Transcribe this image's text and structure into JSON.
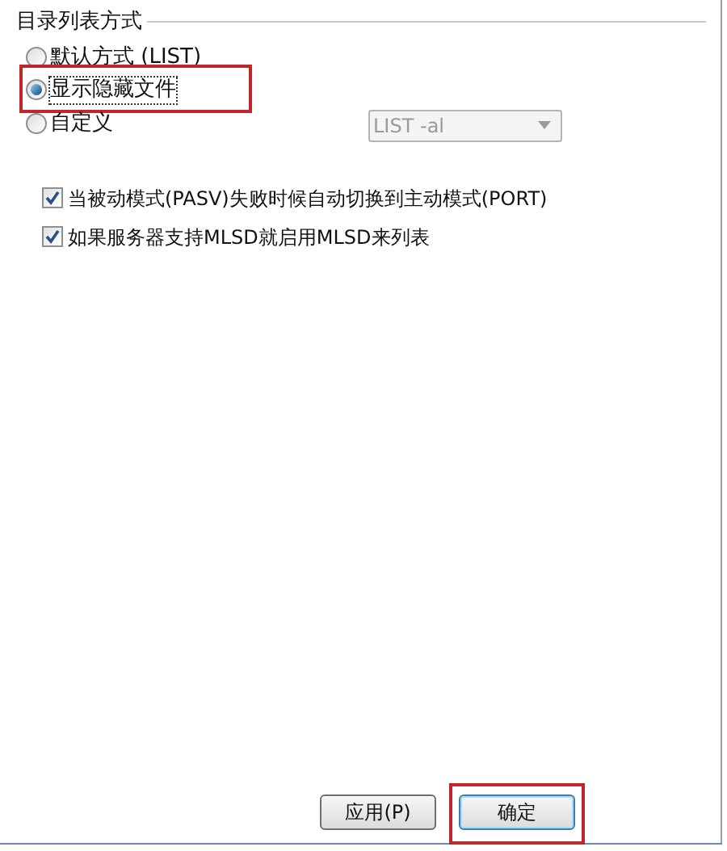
{
  "group": {
    "title": "目录列表方式"
  },
  "list_modes": [
    {
      "label": "默认方式 (LIST)",
      "selected": false,
      "focused": false,
      "highlighted": false
    },
    {
      "label": "显示隐藏文件",
      "selected": true,
      "focused": true,
      "highlighted": true
    },
    {
      "label": "自定义",
      "selected": false,
      "focused": false,
      "highlighted": false
    }
  ],
  "custom_command": {
    "value": "LIST -al",
    "disabled": true
  },
  "options": [
    {
      "label": "当被动模式(PASV)失败时候自动切换到主动模式(PORT)",
      "checked": true
    },
    {
      "label": "如果服务器支持MLSD就启用MLSD来列表",
      "checked": true
    }
  ],
  "buttons": [
    {
      "label": "应用(P)",
      "highlighted": false,
      "default": false
    },
    {
      "label": "确定",
      "highlighted": true,
      "default": true
    }
  ]
}
